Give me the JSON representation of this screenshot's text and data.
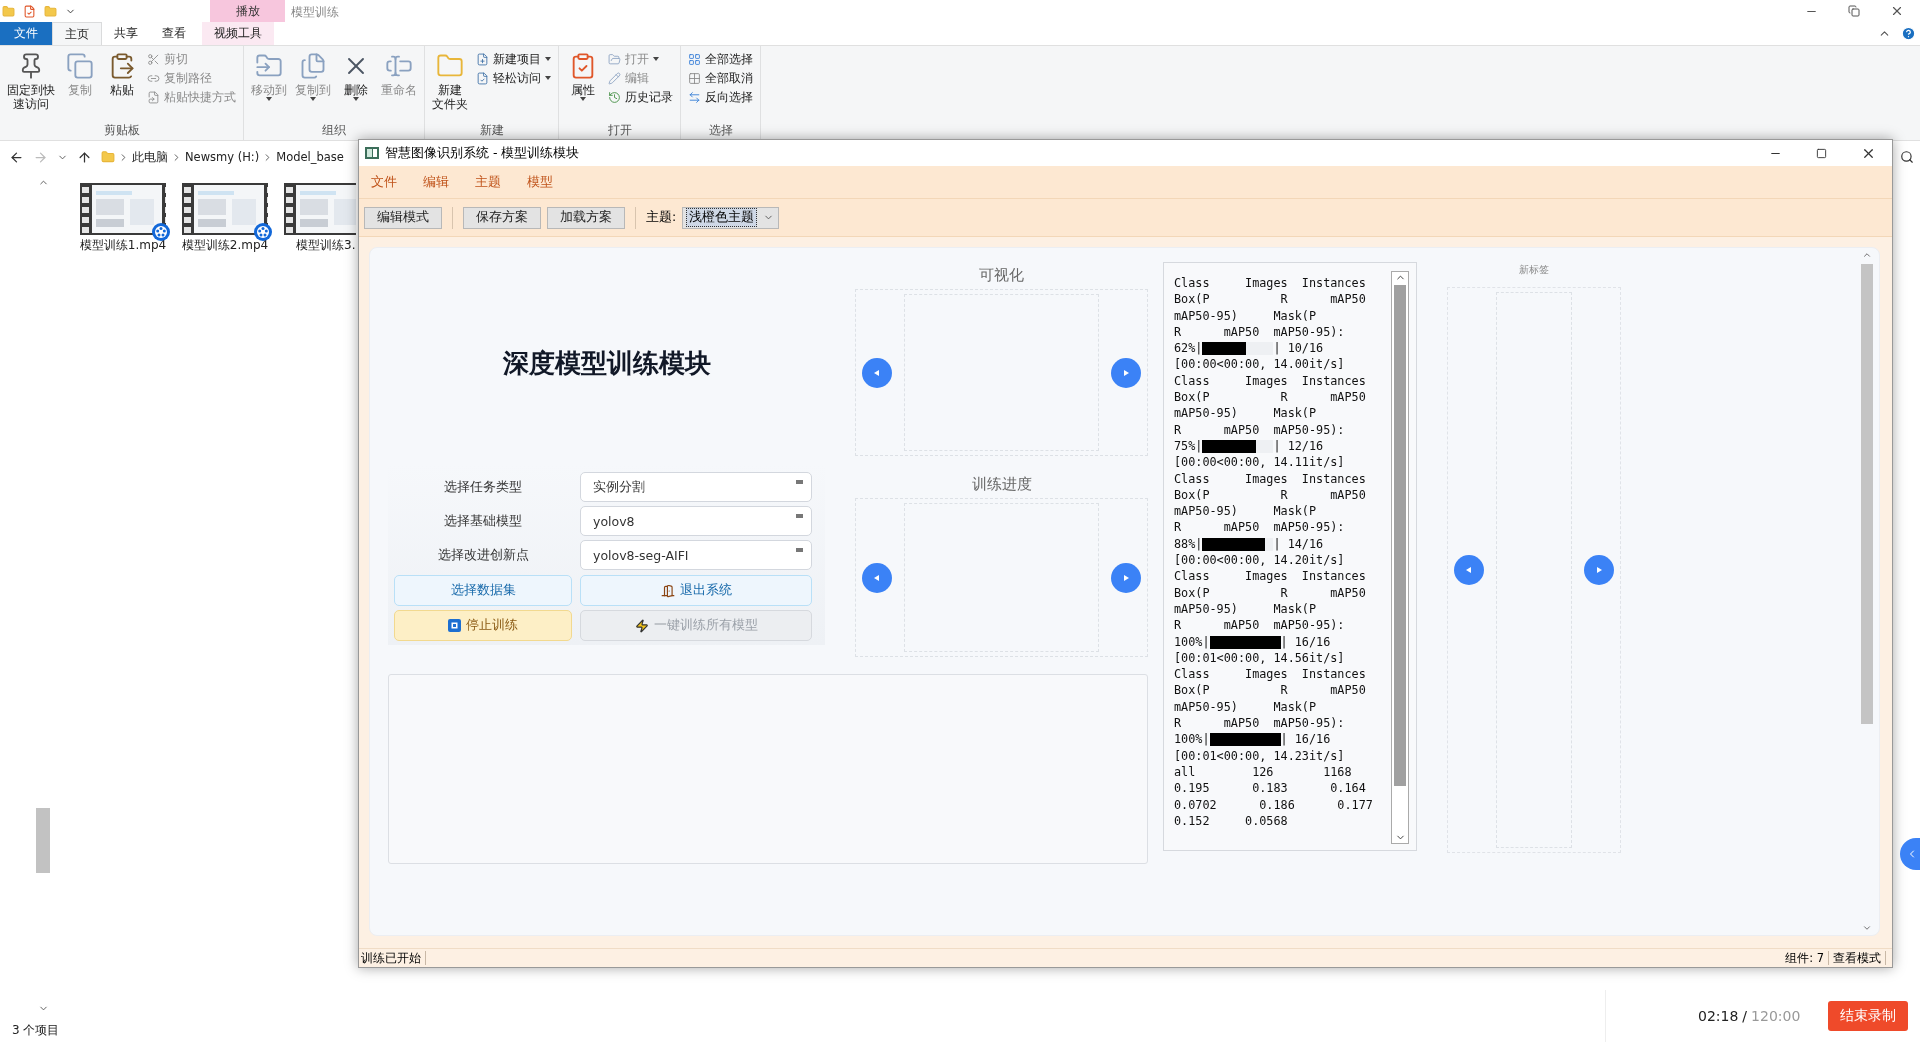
{
  "explorer": {
    "context_group": "播放",
    "window_title": "模型训练",
    "tabs": [
      {
        "label": "文件",
        "kind": "file",
        "selected": false
      },
      {
        "label": "主页",
        "kind": "tab",
        "selected": true
      },
      {
        "label": "共享",
        "kind": "tab",
        "selected": false
      },
      {
        "label": "查看",
        "kind": "tab",
        "selected": false
      },
      {
        "label": "视频工具",
        "kind": "context",
        "selected": false
      }
    ],
    "ribbon": [
      {
        "label": "剪贴板",
        "large": [
          {
            "lines": [
              "固定到快",
              "速访问"
            ],
            "disabled": false,
            "menu": false
          },
          {
            "lines": [
              "复制"
            ],
            "disabled": true,
            "menu": false
          },
          {
            "lines": [
              "粘贴"
            ],
            "disabled": false,
            "menu": false
          }
        ],
        "small": [
          {
            "label": "剪切",
            "disabled": true,
            "menu": false
          },
          {
            "label": "复制路径",
            "disabled": true,
            "menu": false
          },
          {
            "label": "粘贴快捷方式",
            "disabled": true,
            "menu": false
          }
        ]
      },
      {
        "label": "组织",
        "large": [
          {
            "lines": [
              "移动到"
            ],
            "disabled": true,
            "menu": true
          },
          {
            "lines": [
              "复制到"
            ],
            "disabled": true,
            "menu": true
          },
          {
            "lines": [
              "删除"
            ],
            "disabled": false,
            "menu": true
          },
          {
            "lines": [
              "重命名"
            ],
            "disabled": true,
            "menu": false
          }
        ]
      },
      {
        "label": "新建",
        "large": [
          {
            "lines": [
              "新建",
              "文件夹"
            ],
            "disabled": false,
            "menu": false
          }
        ],
        "small": [
          {
            "label": "新建项目",
            "disabled": false,
            "menu": true
          },
          {
            "label": "轻松访问",
            "disabled": false,
            "menu": true
          }
        ]
      },
      {
        "label": "打开",
        "large": [
          {
            "lines": [
              "属性"
            ],
            "disabled": false,
            "menu": true
          }
        ],
        "small": [
          {
            "label": "打开",
            "disabled": true,
            "menu": true
          },
          {
            "label": "编辑",
            "disabled": true,
            "menu": false
          },
          {
            "label": "历史记录",
            "disabled": false,
            "menu": false
          }
        ]
      },
      {
        "label": "选择",
        "small": [
          {
            "label": "全部选择",
            "disabled": false,
            "menu": false
          },
          {
            "label": "全部取消",
            "disabled": false,
            "menu": false
          },
          {
            "label": "反向选择",
            "disabled": false,
            "menu": false
          }
        ]
      }
    ],
    "path": [
      "此电脑",
      "Newsmy (H:)",
      "Model_base"
    ],
    "files": [
      {
        "name": "模型训练1.mp4",
        "badge": true
      },
      {
        "name": "模型训练2.mp4",
        "badge": true
      },
      {
        "name": "模型训练3.",
        "badge": false
      }
    ],
    "status": "3 个项目"
  },
  "app": {
    "title": "智慧图像识别系统 - 模型训练模块",
    "menus": [
      "文件",
      "编辑",
      "主题",
      "模型"
    ],
    "toolbar": [
      "编辑模式",
      "保存方案",
      "加载方案"
    ],
    "theme": {
      "label": "主题:",
      "value": "浅橙色主题"
    },
    "heading": "深度模型训练模块",
    "form": [
      {
        "label": "选择任务类型",
        "value": "实例分割"
      },
      {
        "label": "选择基础模型",
        "value": "yolov8"
      },
      {
        "label": "选择改进创新点",
        "value": "yolov8-seg-AIFI"
      }
    ],
    "buttons": [
      {
        "label": "选择数据集",
        "kind": "plain",
        "disabled": false
      },
      {
        "label": "退出系统",
        "kind": "exit",
        "disabled": false
      },
      {
        "label": "停止训练",
        "kind": "stop",
        "disabled": false
      },
      {
        "label": "一键训练所有模型",
        "kind": "train_all",
        "disabled": true
      }
    ],
    "panels": [
      {
        "title": "可视化"
      },
      {
        "title": "训练进度"
      }
    ],
    "log": [
      {
        "kind": "text",
        "text": "Class     Images  Instances"
      },
      {
        "kind": "text",
        "text": "Box(P          R      mAP50"
      },
      {
        "kind": "text",
        "text": "mAP50-95)     Mask(P"
      },
      {
        "kind": "text",
        "text": "R      mAP50  mAP50-95):"
      },
      {
        "kind": "progress",
        "prefix": "62%|",
        "level": 0.62,
        "suffix": "| 10/16"
      },
      {
        "kind": "text",
        "text": "[00:00<00:00, 14.00it/s]"
      },
      {
        "kind": "text",
        "text": "Class     Images  Instances"
      },
      {
        "kind": "text",
        "text": "Box(P          R      mAP50"
      },
      {
        "kind": "text",
        "text": "mAP50-95)     Mask(P"
      },
      {
        "kind": "text",
        "text": "R      mAP50  mAP50-95):"
      },
      {
        "kind": "progress",
        "prefix": "75%|",
        "level": 0.75,
        "suffix": "| 12/16"
      },
      {
        "kind": "text",
        "text": "[00:00<00:00, 14.11it/s]"
      },
      {
        "kind": "text",
        "text": "Class     Images  Instances"
      },
      {
        "kind": "text",
        "text": "Box(P          R      mAP50"
      },
      {
        "kind": "text",
        "text": "mAP50-95)     Mask(P"
      },
      {
        "kind": "text",
        "text": "R      mAP50  mAP50-95):"
      },
      {
        "kind": "progress",
        "prefix": "88%|",
        "level": 0.88,
        "suffix": "| 14/16"
      },
      {
        "kind": "text",
        "text": "[00:00<00:00, 14.20it/s]"
      },
      {
        "kind": "text",
        "text": "Class     Images  Instances"
      },
      {
        "kind": "text",
        "text": "Box(P          R      mAP50"
      },
      {
        "kind": "text",
        "text": "mAP50-95)     Mask(P"
      },
      {
        "kind": "text",
        "text": "R      mAP50  mAP50-95):"
      },
      {
        "kind": "progress",
        "prefix": "100%|",
        "level": 1,
        "suffix": "| 16/16"
      },
      {
        "kind": "text",
        "text": "[00:01<00:00, 14.56it/s]"
      },
      {
        "kind": "text",
        "text": "Class     Images  Instances"
      },
      {
        "kind": "text",
        "text": "Box(P          R      mAP50"
      },
      {
        "kind": "text",
        "text": "mAP50-95)     Mask(P"
      },
      {
        "kind": "text",
        "text": "R      mAP50  mAP50-95):"
      },
      {
        "kind": "progress",
        "prefix": "100%|",
        "level": 1,
        "suffix": "| 16/16"
      },
      {
        "kind": "text",
        "text": "[00:01<00:00, 14.23it/s]"
      },
      {
        "kind": "text",
        "text": "all        126       1168"
      },
      {
        "kind": "text",
        "text": "0.195      0.183      0.164"
      },
      {
        "kind": "text",
        "text": "0.0702      0.186      0.177"
      },
      {
        "kind": "text",
        "text": "0.152     0.0568"
      }
    ],
    "side_panel": {
      "title": "新标签"
    },
    "status_left": "训练已开始",
    "status_count": "组件: 7",
    "status_mode": "查看模式"
  },
  "recorder": {
    "elapsed": "02:18",
    "separator": "/",
    "total": "120:00",
    "stop_button": "结束录制"
  }
}
